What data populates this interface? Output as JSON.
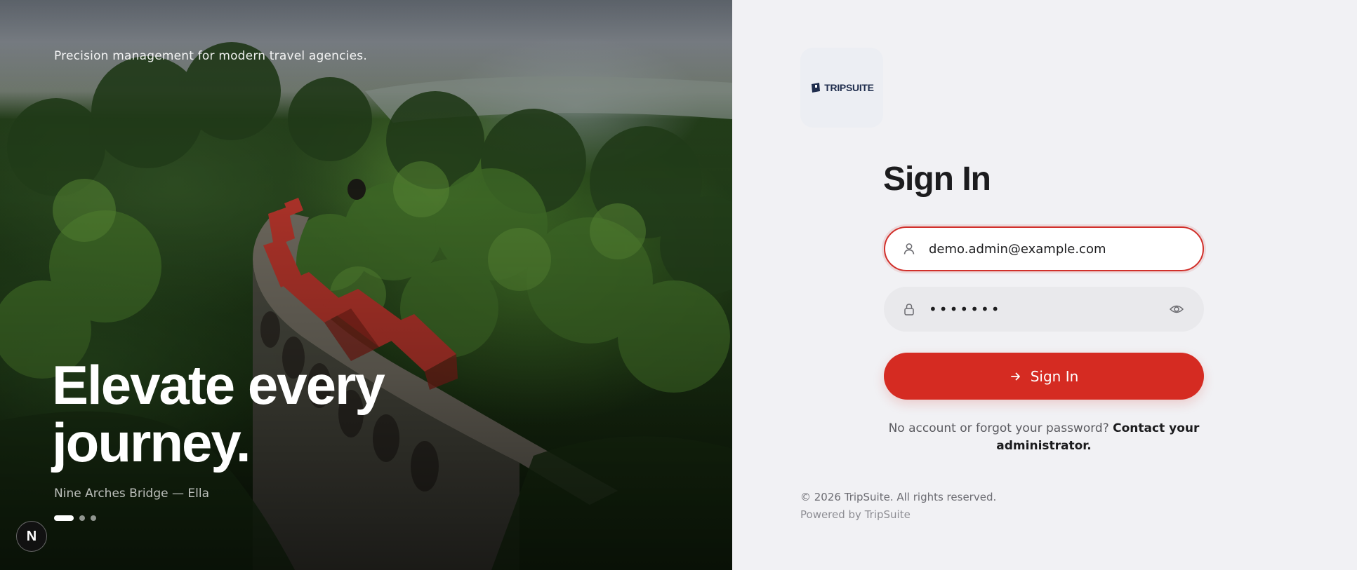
{
  "hero": {
    "tagline": "Precision management for modern travel agencies.",
    "headline": "Elevate every journey.",
    "caption": "Nine Arches Bridge — Ella",
    "slides": {
      "count": 3,
      "active": 0
    },
    "badge_letter": "N"
  },
  "brand": {
    "logo_text": "TRIPSUITE",
    "logo_color": "#1f2d4d"
  },
  "form": {
    "title": "Sign In",
    "email_value": "demo.admin@example.com",
    "password_value": "•••••••",
    "submit_label": "Sign In",
    "help_text": "No account or forgot your password?",
    "help_link": "Contact your administrator."
  },
  "footer": {
    "copyright": "© 2026 TripSuite. All rights reserved.",
    "powered": "Powered by TripSuite"
  },
  "colors": {
    "accent": "#d52b22",
    "panel_bg": "#f1f1f4",
    "input_bg": "#e9e9ec"
  },
  "icons": [
    "user-icon",
    "lock-icon",
    "eye-icon",
    "arrow-right-icon",
    "logo-mark-icon"
  ]
}
